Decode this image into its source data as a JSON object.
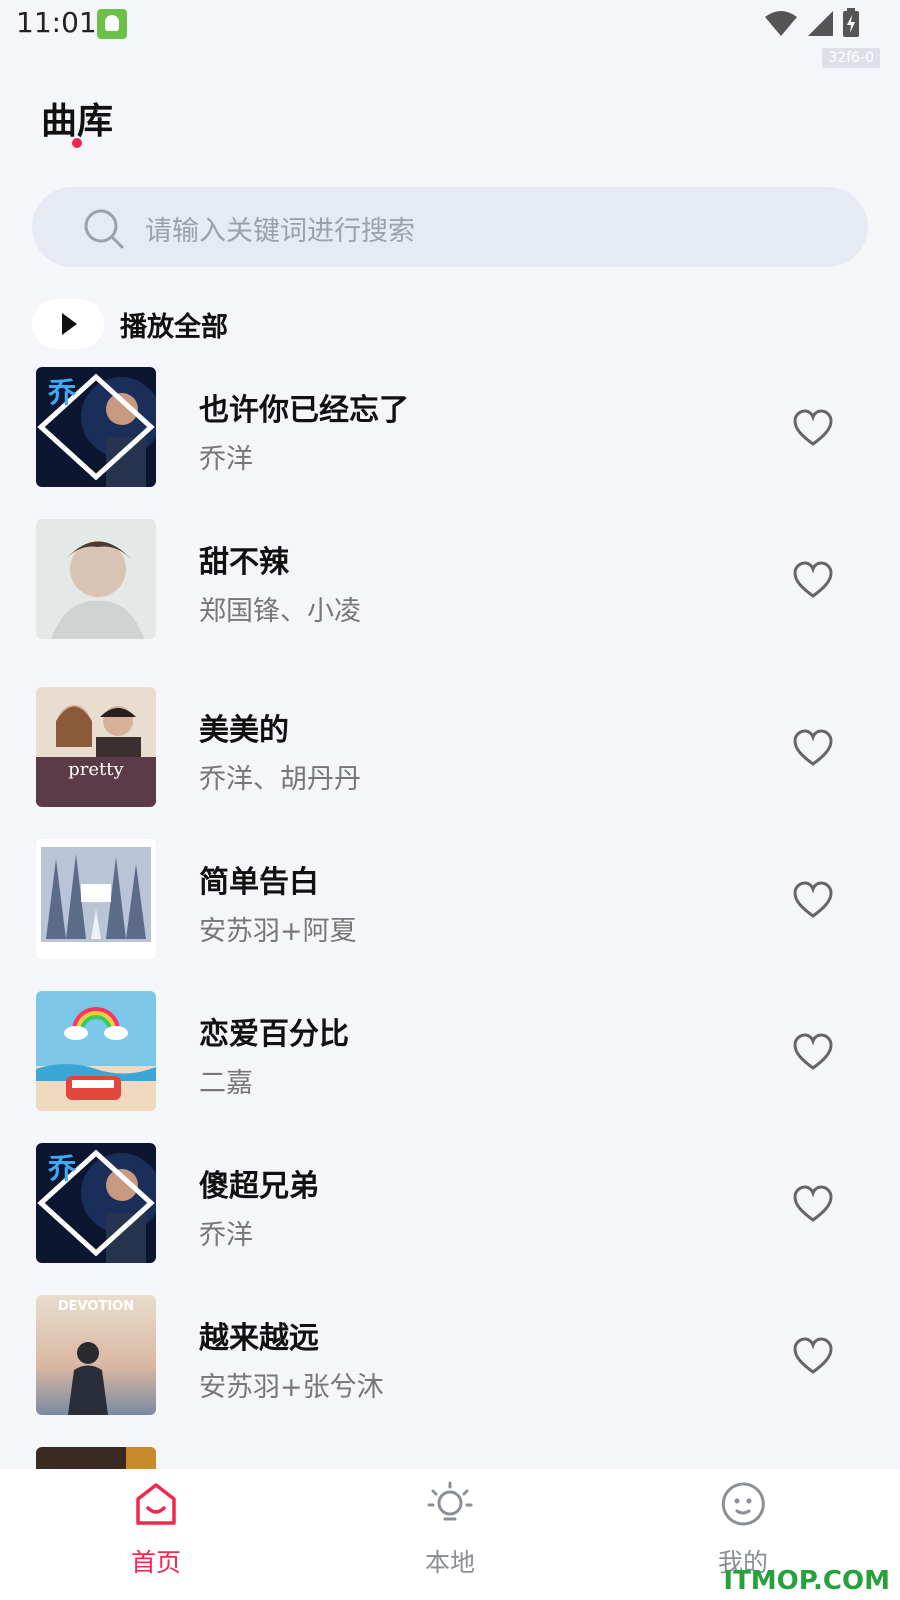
{
  "status_bar": {
    "time": "11:01",
    "build_tag": "32f6-0"
  },
  "header": {
    "title": "曲库"
  },
  "search": {
    "placeholder": "请输入关键词进行搜索"
  },
  "play_all": {
    "label": "播放全部"
  },
  "songs": [
    {
      "title": "也许你已经忘了",
      "artist": "乔洋",
      "cover": "dark-blue-cover"
    },
    {
      "title": "甜不辣",
      "artist": "郑国锋、小凌",
      "cover": "pale-portrait-cover"
    },
    {
      "title": "美美的",
      "artist": "乔洋、胡丹丹",
      "cover": "pretty-cover",
      "cover_text": "pretty"
    },
    {
      "title": "简单告白",
      "artist": "安苏羽+阿夏",
      "cover": "winter-forest-cover"
    },
    {
      "title": "恋爱百分比",
      "artist": "二嘉",
      "cover": "beach-bus-cover"
    },
    {
      "title": "傻超兄弟",
      "artist": "乔洋",
      "cover": "dark-blue-cover"
    },
    {
      "title": "越来越远",
      "artist": "安苏羽+张兮沐",
      "cover": "devotion-cover",
      "cover_text": "DEVOTION"
    }
  ],
  "bottom_nav": [
    {
      "label": "首页",
      "icon": "home-icon",
      "active": true
    },
    {
      "label": "本地",
      "icon": "bulb-icon",
      "active": false
    },
    {
      "label": "我的",
      "icon": "face-icon",
      "active": false
    }
  ],
  "watermark": "ITMOP.COM",
  "colors": {
    "accent": "#f2274e",
    "background": "#f4f6fa",
    "search_bg": "#e6ebf3"
  }
}
